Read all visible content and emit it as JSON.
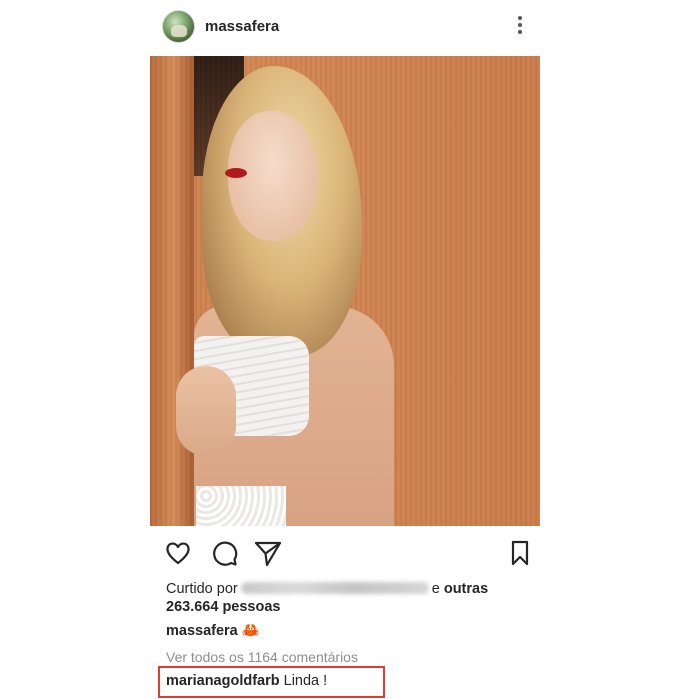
{
  "post": {
    "username": "massafera",
    "avatar_icon": "profile-avatar",
    "more_icon": "three-dots-vertical-icon"
  },
  "actions": {
    "like_icon": "heart-icon",
    "comment_icon": "comment-bubble-icon",
    "share_icon": "paper-plane-icon",
    "save_icon": "bookmark-icon"
  },
  "likes": {
    "prefix": "Curtido por",
    "obscured_names": "[blurred usernames]",
    "joiner": "e",
    "others": "outras",
    "count_line": "263.664 pessoas"
  },
  "caption": {
    "username": "massafera",
    "emoji": "🦀"
  },
  "comments": {
    "view_all": "Ver todos os 1164 comentários",
    "first": {
      "username": "marianagoldfarb",
      "text": "Linda !"
    }
  },
  "colors": {
    "highlight_border": "#e43a33",
    "text": "#262626",
    "muted": "#8e8e8e"
  }
}
